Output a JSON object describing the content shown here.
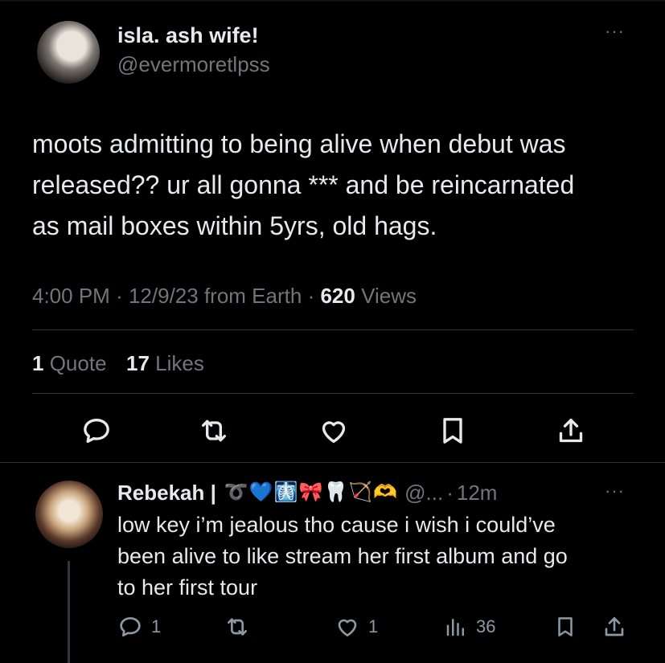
{
  "tweet": {
    "display_name": "isla. ash wife!",
    "handle": "@evermoretlpss",
    "text_lines": [
      "moots admitting to being alive when debut was",
      "released?? ur all gonna *** and be reincarnated",
      "as mail boxes within 5yrs, old hags."
    ],
    "time": "4:00 PM",
    "dot": "·",
    "date": "12/9/23",
    "source": "from Earth",
    "views_count": "620",
    "views_label": "Views",
    "quotes_count": "1",
    "quotes_label": "Quote",
    "likes_count": "17",
    "likes_label": "Likes",
    "more": "···"
  },
  "reply": {
    "display_name": "Rebekah |",
    "emojis": [
      "➰",
      "💙",
      "🩻",
      "🎀",
      "🦷",
      "🏹",
      "🫶"
    ],
    "handle": "@...",
    "dot": "·",
    "time": "12m",
    "more": "···",
    "text_lines": [
      "low key i’m jealous tho cause i wish i could’ve",
      "been alive to like stream her first album and go",
      "to her first tour"
    ],
    "replies_count": "1",
    "likes_count": "1",
    "views_count": "36"
  },
  "icons": {
    "reply": "reply-bubble-icon",
    "retweet": "retweet-icon",
    "like": "heart-icon",
    "bookmark": "bookmark-icon",
    "share": "share-icon",
    "views": "views-bar-chart-icon"
  }
}
